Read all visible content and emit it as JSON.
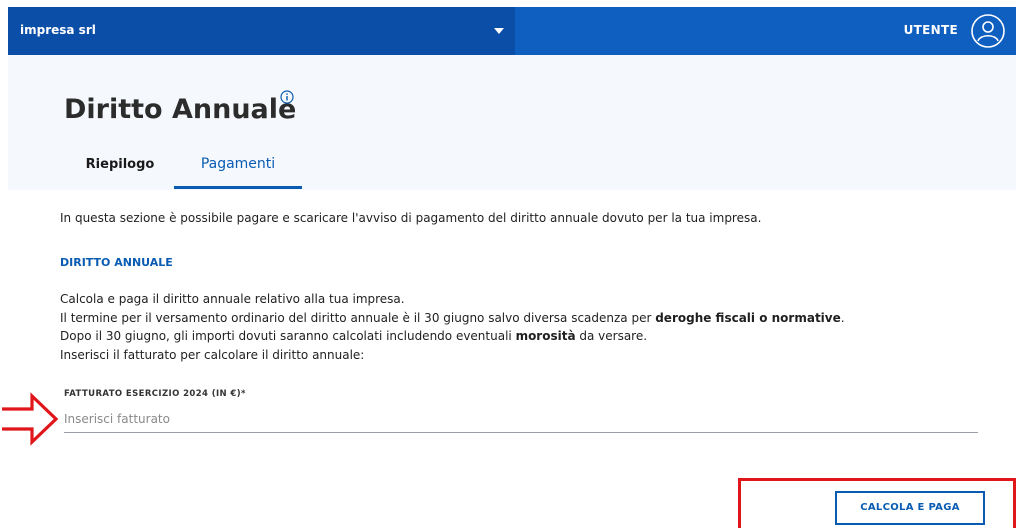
{
  "topbar": {
    "company": "impresa srl",
    "user_label": "UTENTE",
    "icons": {
      "dropdown": "chevron-down-icon",
      "avatar": "user-avatar-icon"
    },
    "colors": {
      "bar": "#0f5fc0",
      "select": "#0a4ea8"
    }
  },
  "page": {
    "title": "Diritto Annuale",
    "info_icon": "info-icon"
  },
  "tabs": [
    {
      "label": "Riepilogo",
      "active": false
    },
    {
      "label": "Pagamenti",
      "active": true
    }
  ],
  "content": {
    "intro": "In questa sezione è possibile pagare e scaricare l'avviso di pagamento del diritto annuale dovuto per la tua impresa.",
    "section_title": "DIRITTO ANNUALE",
    "line1": "Calcola e paga il diritto annuale relativo alla tua impresa.",
    "line2_pre": "Il termine per il versamento ordinario del diritto annuale è il 30 giugno salvo diversa scadenza per ",
    "line2_bold": "deroghe fiscali o normative",
    "line2_post": ".",
    "line3_pre": "Dopo il 30 giugno, gli importi dovuti saranno calcolati includendo eventuali ",
    "line3_bold": "morosità",
    "line3_post": " da versare.",
    "line4": "Inserisci il fatturato per calcolare il diritto annuale:"
  },
  "form": {
    "field_label": "FATTURATO ESERCIZIO 2024 (IN €)*",
    "placeholder": "Inserisci fatturato",
    "value": ""
  },
  "actions": {
    "submit_label": "CALCOLA E PAGA"
  },
  "annotations": {
    "color": "#e0161b",
    "arrow_icon": "arrow-right-icon"
  }
}
